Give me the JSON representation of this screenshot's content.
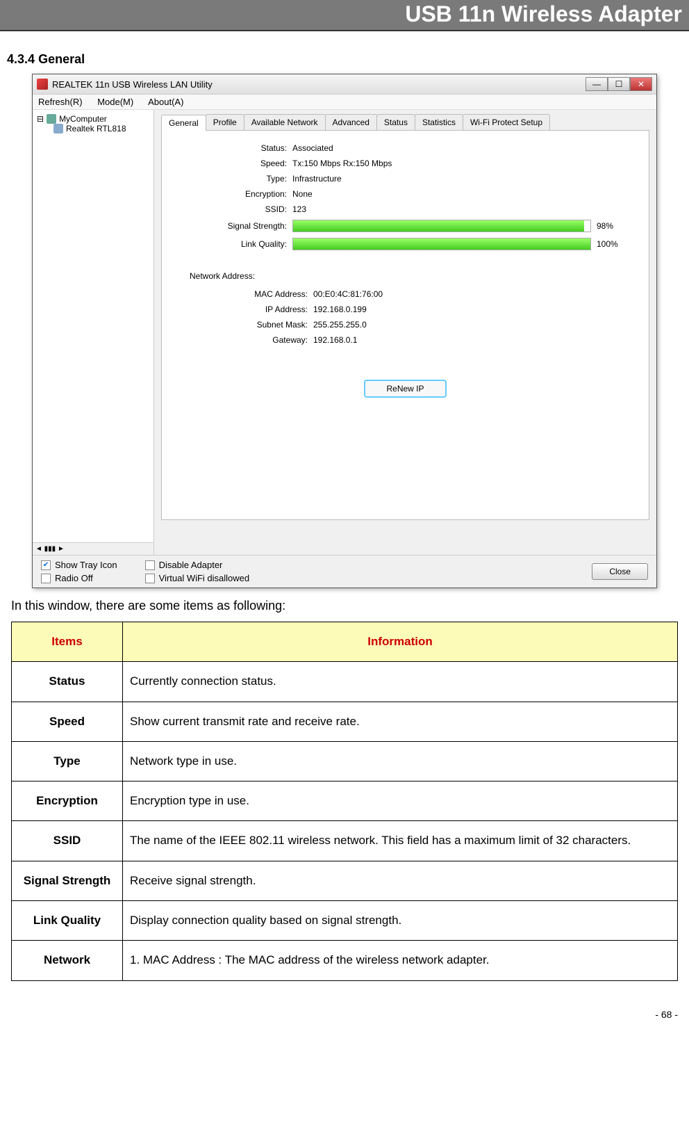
{
  "page": {
    "header_title": "USB 11n Wireless Adapter",
    "section_number": "4.3.4",
    "section_name": " General",
    "intro": "In this window, there are some items as following:",
    "page_number": "- 68 -"
  },
  "app": {
    "title": "REALTEK 11n USB Wireless LAN Utility",
    "menu": {
      "refresh": "Refresh(R)",
      "mode": "Mode(M)",
      "about": "About(A)"
    },
    "tree": {
      "root": "MyComputer",
      "child": "Realtek RTL818"
    },
    "tabs": [
      "General",
      "Profile",
      "Available Network",
      "Advanced",
      "Status",
      "Statistics",
      "Wi-Fi Protect Setup"
    ],
    "fields": {
      "status_label": "Status:",
      "status_value": "Associated",
      "speed_label": "Speed:",
      "speed_value": "Tx:150 Mbps Rx:150 Mbps",
      "type_label": "Type:",
      "type_value": "Infrastructure",
      "enc_label": "Encryption:",
      "enc_value": "None",
      "ssid_label": "SSID:",
      "ssid_value": "123",
      "sig_label": "Signal Strength:",
      "sig_pct": "98%",
      "lq_label": "Link Quality:",
      "lq_pct": "100%"
    },
    "netaddr": {
      "section": "Network Address:",
      "mac_label": "MAC Address:",
      "mac_value": "00:E0:4C:81:76:00",
      "ip_label": "IP Address:",
      "ip_value": "192.168.0.199",
      "mask_label": "Subnet Mask:",
      "mask_value": "255.255.255.0",
      "gw_label": "Gateway:",
      "gw_value": "192.168.0.1"
    },
    "renew": "ReNew IP",
    "bottom": {
      "show_tray": "Show Tray Icon",
      "radio_off": "Radio Off",
      "disable_adapter": "Disable Adapter",
      "virtual_wifi": "Virtual WiFi disallowed",
      "close": "Close"
    }
  },
  "table": {
    "hdr_items": "Items",
    "hdr_info": "Information",
    "rows": [
      {
        "item": "Status",
        "info": "Currently connection status."
      },
      {
        "item": "Speed",
        "info": "Show current transmit rate and receive rate."
      },
      {
        "item": "Type",
        "info": "Network type in use."
      },
      {
        "item": "Encryption",
        "info": "Encryption type in use."
      },
      {
        "item": "SSID",
        "info": "The name of the IEEE 802.11 wireless network. This field has a maximum limit of 32 characters."
      },
      {
        "item": "Signal Strength",
        "info": "Receive signal strength."
      },
      {
        "item": "Link Quality",
        "info": "Display connection quality based on signal strength."
      },
      {
        "item": "Network",
        "info": "1. MAC Address : The MAC address of the wireless network adapter."
      }
    ]
  }
}
